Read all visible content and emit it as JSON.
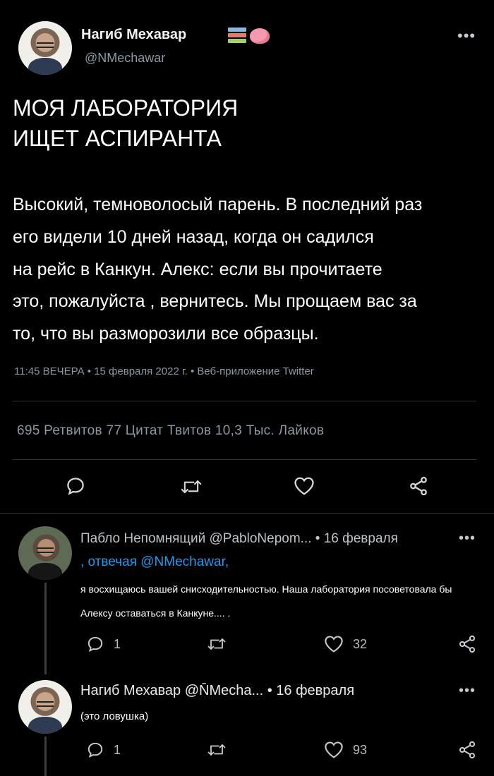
{
  "main_tweet": {
    "author_name": "Нагиб Мехавар",
    "author_handle": "@NMechawar",
    "more_label": "•••",
    "title_lines": [
      "МОЯ ЛАБОРАТОРИЯ",
      "ИЩЕТ АСПИРАНТА"
    ],
    "body_lines": [
      "Высокий, темноволосый парень. В последний раз",
      "его видели 10 дней назад, когда он садился",
      "на рейс в Канкун. Алекс: если вы прочитаете",
      "это, пожалуйста , вернитесь. Мы прощаем вас за",
      "то, что вы разморозили все образцы."
    ],
    "meta": "11:45 ВЕЧЕРА • 15 февраля 2022 г. • Веб-приложение Twitter",
    "stats": "695 Ретвитов 77 Цитат Твитов 10,3 Тыс. Лайков",
    "emoji": [
      "books-emoji",
      "brain-emoji"
    ]
  },
  "replies": [
    {
      "header": "Пабло Непомнящий @PabloNepom... • 16 февраля",
      "more_label": "•••",
      "replying_to": ", отвечая @NMechawar,",
      "text_lines": [
        "я восхищаюсь вашей снисходительностью. Наша лаборатория посоветовала бы",
        "Алексу оставаться в Канкуне.... ."
      ],
      "replies_count": "1",
      "likes_count": "32"
    },
    {
      "header": "Нагиб Мехавар @N̄Mecha... • 16 февраля",
      "more_label": "•••",
      "text_lines": [
        "(это ловушка)"
      ],
      "replies_count": "1",
      "likes_count": "93"
    }
  ],
  "icons": {
    "reply": "reply-icon",
    "retweet": "retweet-icon",
    "like": "heart-icon",
    "share": "share-icon",
    "more": "more-icon"
  },
  "colors": {
    "background": "#000000",
    "link": "#1d9bf0",
    "muted": "#8b98a5",
    "divider": "#2f3336"
  }
}
